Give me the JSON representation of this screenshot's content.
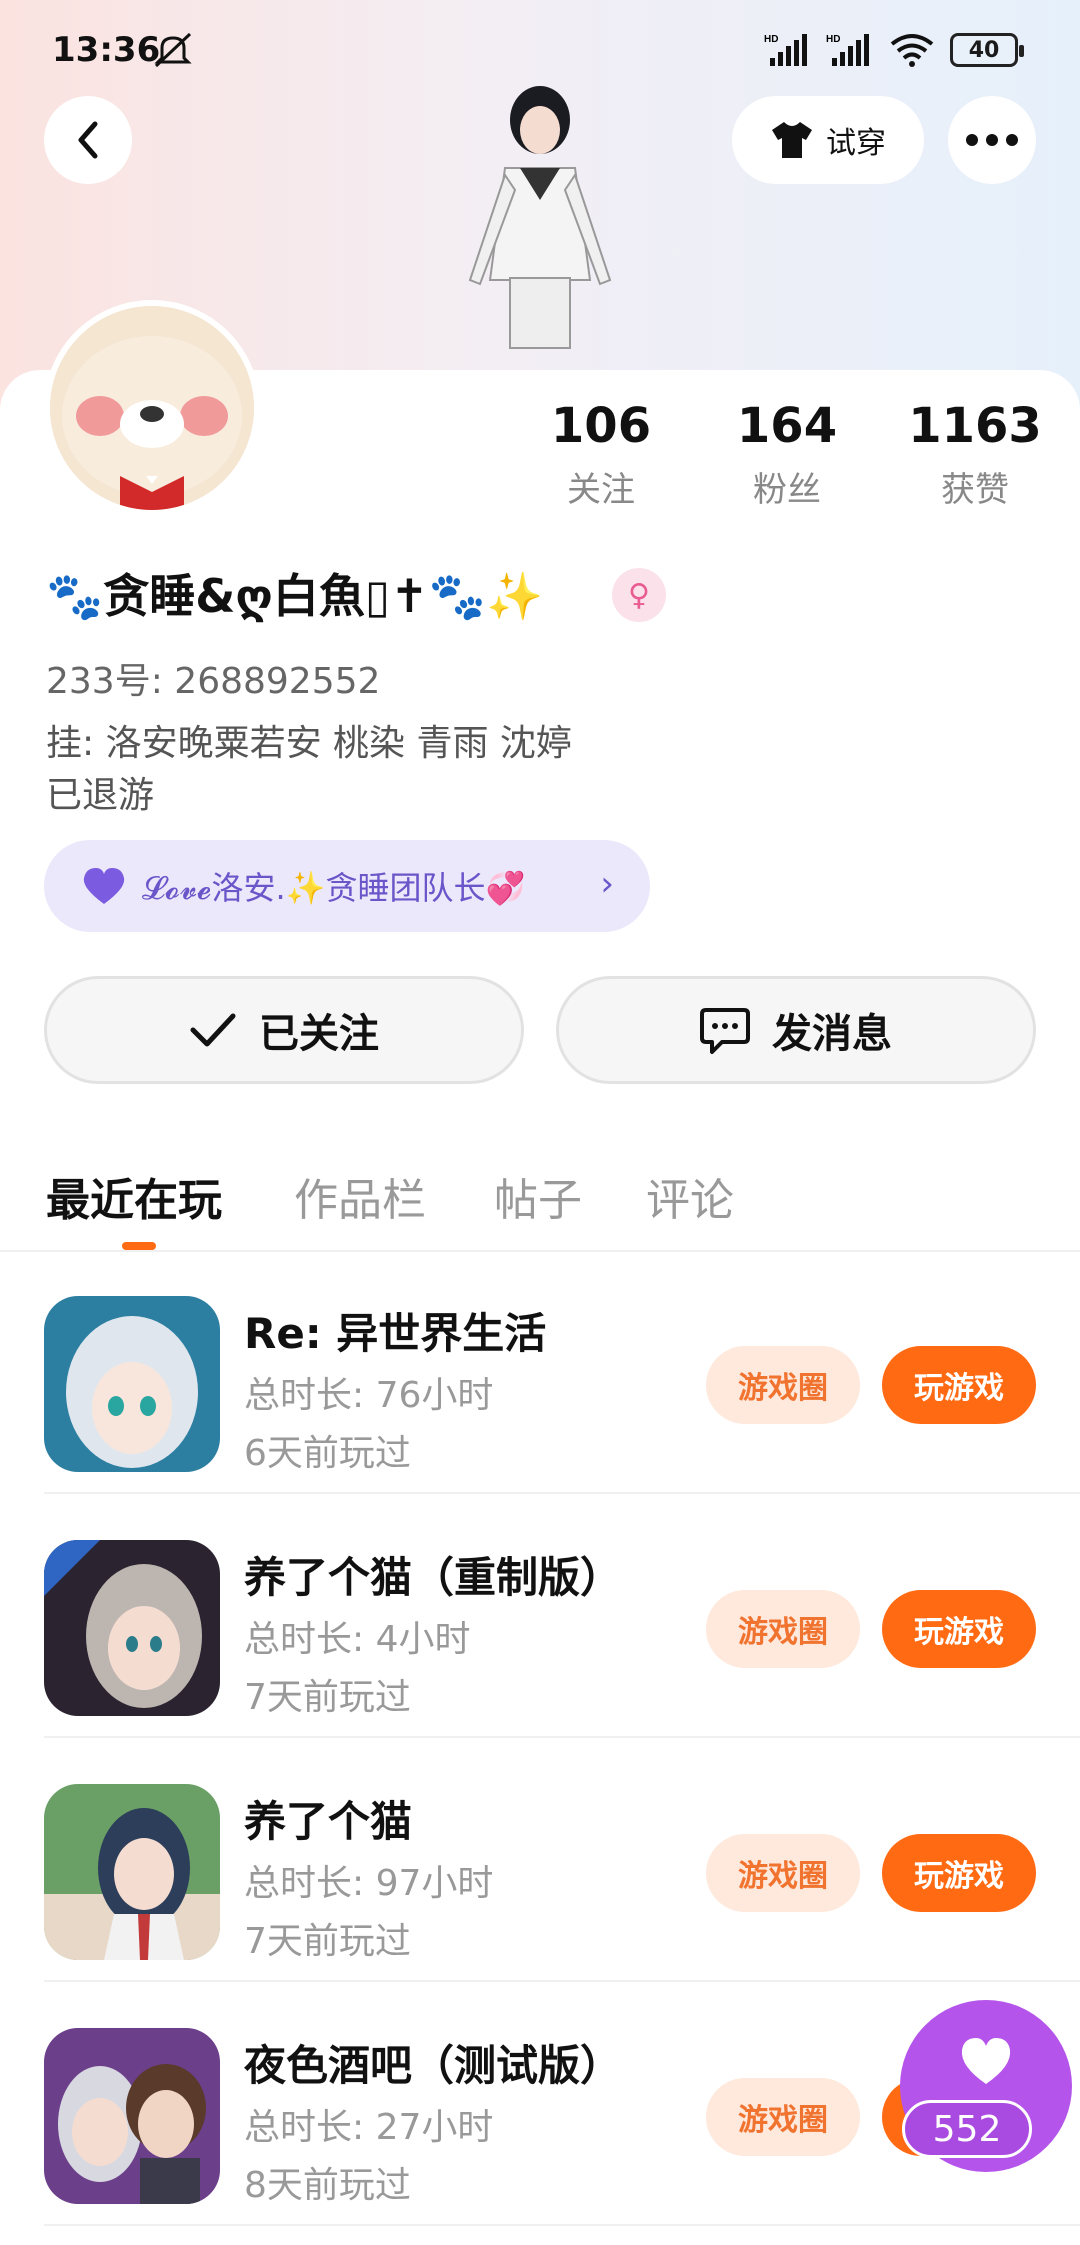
{
  "status_bar": {
    "time": "13:36",
    "battery": "40"
  },
  "header": {
    "try_on_label": "试穿"
  },
  "profile": {
    "name": "🐾贪睡&ღ白魚▯✝🐾✨",
    "gender_symbol": "♀",
    "uid": "233号: 268892552",
    "bio_line1": "挂: 洛安晚粟若安 桃染 青雨 沈婷",
    "bio_line2": "已退游",
    "team_label": "𝓛𝓸𝓿𝓮洛安.✨贪睡团队长💞"
  },
  "stats": [
    {
      "value": "106",
      "label": "关注"
    },
    {
      "value": "164",
      "label": "粉丝"
    },
    {
      "value": "1163",
      "label": "获赞"
    }
  ],
  "actions": {
    "follow_label": "已关注",
    "message_label": "发消息"
  },
  "tabs": [
    "最近在玩",
    "作品栏",
    "帖子",
    "评论"
  ],
  "game_buttons": {
    "circle_label": "游戏圈",
    "play_label": "玩游戏"
  },
  "games": [
    {
      "title": "Re: 异世界生活",
      "total_time": "总时长: 76小时",
      "last_played": "6天前玩过",
      "icon": "anime-girl-silver-hair",
      "color": "#2c7fa0"
    },
    {
      "title": "养了个猫（重制版）",
      "total_time": "总时长: 4小时",
      "last_played": "7天前玩过",
      "icon": "anime-catgirl-dark",
      "color": "#2b2430"
    },
    {
      "title": "养了个猫",
      "total_time": "总时长: 97小时",
      "last_played": "7天前玩过",
      "icon": "anime-girl-school",
      "color": "#6aa066"
    },
    {
      "title": "夜色酒吧（测试版）",
      "total_time": "总时长: 27小时",
      "last_played": "8天前玩过",
      "icon": "anime-couple",
      "color": "#6b3f8a"
    }
  ],
  "floating_like": {
    "count": "552",
    "color": "#b554ea"
  },
  "colors": {
    "accent": "#ff6a13",
    "accent_soft": "#ffe8dc",
    "team_pill": "#ece8fb"
  }
}
